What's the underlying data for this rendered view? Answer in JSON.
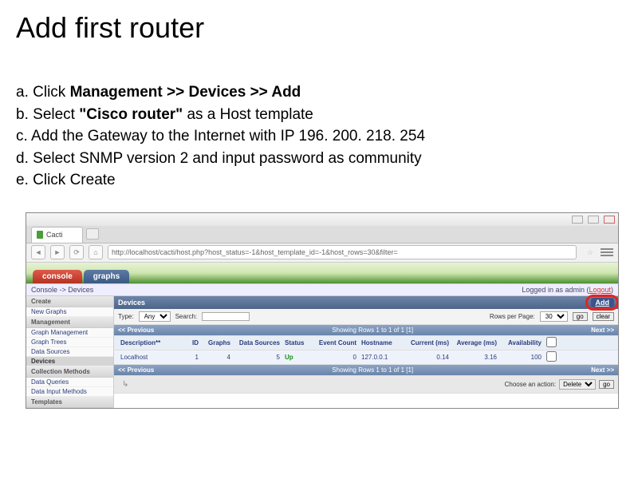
{
  "title": "Add first router",
  "steps": {
    "a": {
      "letter": "a.",
      "pre": "Click ",
      "bold": "Management >> Devices >> Add",
      "post": ""
    },
    "b": {
      "letter": "b.",
      "pre": "Select ",
      "bold": "\"Cisco router\"",
      "post": " as a Host template"
    },
    "c": {
      "letter": "c.",
      "pre": "",
      "bold": "",
      "post": "Add the Gateway to the Internet with IP 196. 200. 218. 254"
    },
    "d": {
      "letter": "d.",
      "pre": "",
      "bold": "",
      "post": "Select SNMP version 2 and input password as community"
    },
    "e": {
      "letter": "e.",
      "pre": "",
      "bold": "",
      "post": "Click Create"
    }
  },
  "browser": {
    "tab_label": "Cacti",
    "url": "http://localhost/cacti/host.php?host_status=-1&host_template_id=-1&host_rows=30&filter="
  },
  "app": {
    "tabs": {
      "console": "console",
      "graphs": "graphs"
    },
    "breadcrumb": "Console -> Devices",
    "logged_in": "Logged in as admin (",
    "logout": "Logout",
    "logged_in_close": ")"
  },
  "sidebar": {
    "h_create": "Create",
    "new_graphs": "New Graphs",
    "h_management": "Management",
    "graph_mgmt": "Graph Management",
    "graph_trees": "Graph Trees",
    "data_sources": "Data Sources",
    "devices": "Devices",
    "h_collection": "Collection Methods",
    "data_queries": "Data Queries",
    "data_input": "Data Input Methods",
    "h_templates": "Templates"
  },
  "panel": {
    "title": "Devices",
    "add": "Add",
    "filter": {
      "type_label": "Type:",
      "type_value": "Any",
      "search_label": "Search:",
      "search_value": "",
      "rows_label": "Rows per Page:",
      "rows_value": "30",
      "go": "go",
      "clear": "clear"
    },
    "pager": {
      "prev": "<< Previous",
      "status": "Showing Rows 1 to 1 of 1 [1]",
      "next": "Next >>"
    },
    "cols": {
      "desc": "Description**",
      "id": "ID",
      "graphs": "Graphs",
      "ds": "Data Sources",
      "status": "Status",
      "events": "Event Count",
      "host": "Hostname",
      "current": "Current (ms)",
      "average": "Average (ms)",
      "avail": "Availability"
    },
    "row": {
      "desc": "Localhost",
      "id": "1",
      "graphs": "4",
      "ds": "5",
      "status": "Up",
      "events": "0",
      "host": "127.0.0.1",
      "current": "0.14",
      "average": "3.16",
      "avail": "100"
    },
    "action": {
      "label": "Choose an action:",
      "value": "Delete",
      "go": "go"
    },
    "expand": "↳"
  }
}
